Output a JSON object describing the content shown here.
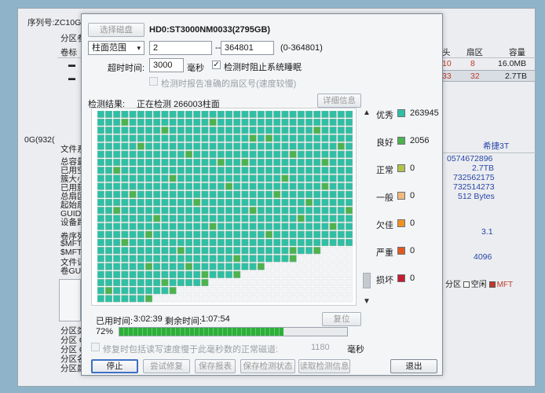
{
  "background": {
    "serial_label": "序列号:ZC10GT",
    "partition_label": "分区参",
    "volume_label": "卷标",
    "size_item": "0G(932(",
    "file_sys": "文件系",
    "info_labels": [
      "总容量",
      "已用空",
      "簇大小",
      "已用簇",
      "总扇区",
      "起始扇",
      "GUID路",
      "设备路"
    ],
    "serial_labels": [
      "卷序列",
      "$MFT",
      "$MFTI",
      "文件记",
      "卷GUI"
    ],
    "bottom_labels": [
      "分区类",
      "分区 G",
      "分区 G",
      "分区名",
      "分区属"
    ],
    "col_head": "头",
    "col_sector": "扇区",
    "col_capacity": "容量",
    "row1": {
      "head": "10",
      "sector": "8",
      "capacity": "16.0MB"
    },
    "row2": {
      "head": "33",
      "sector": "32",
      "capacity": "2.7TB"
    },
    "brand": "希捷3T",
    "values": [
      "0574672896",
      "2.7TB",
      "732562175",
      "732514273",
      "512 Bytes"
    ],
    "mft_val1": "3.1",
    "mft_val2": "4096",
    "legend_bg_tail": "分区",
    "legend_free": "空闲",
    "legend_mft": "MFT"
  },
  "dialog": {
    "select_disk": "选择磁盘",
    "disk_title": "HD0:ST3000NM0033(2795GB)",
    "range_mode": "柱面范围",
    "range_start": "2",
    "arrow": "-->",
    "range_end": "364801",
    "range_hint": "(0-364801)",
    "timeout_label": "超时时间:",
    "timeout_value": "3000",
    "timeout_unit": "毫秒",
    "prevent_sleep": "检测时阻止系统睡眠",
    "prevent_sleep_checked": "✓",
    "report_sector": "检测时报告准确的扇区号(速度较慢)",
    "result_label": "检测结果:",
    "status_text": "正在检测 266003柱面",
    "detail_button": "详细信息",
    "legend": [
      {
        "name": "优秀",
        "count": "263945",
        "color": "#2ebfa5"
      },
      {
        "name": "良好",
        "count": "2056",
        "color": "#4db34d"
      },
      {
        "name": "正常",
        "count": "0",
        "color": "#b5c24a"
      },
      {
        "name": "一般",
        "count": "0",
        "color": "#f2b97c"
      },
      {
        "name": "欠佳",
        "count": "0",
        "color": "#f0921e"
      },
      {
        "name": "严重",
        "count": "0",
        "color": "#e05a1e"
      },
      {
        "name": "损坏",
        "count": "0",
        "color": "#c41e2e"
      }
    ],
    "elapsed_label": "已用时间:",
    "elapsed_value": "3:02:39",
    "remaining_label": "剩余时间:",
    "remaining_value": "1:07:54",
    "reset_button": "复位",
    "progress_text": "72%",
    "progress_fraction": 0.72,
    "repair_label": "修复时包括读写速度慢于此毫秒数的正常磁道:",
    "repair_value": "1180",
    "repair_unit": "毫秒",
    "buttons": {
      "stop": "停止",
      "try_repair": "尝试修复",
      "save_report": "保存报表",
      "save_state": "保存检测状态",
      "load_state": "读取检测信息",
      "exit": "退出"
    },
    "scroll_up": "▲",
    "scroll_down": "▼"
  }
}
